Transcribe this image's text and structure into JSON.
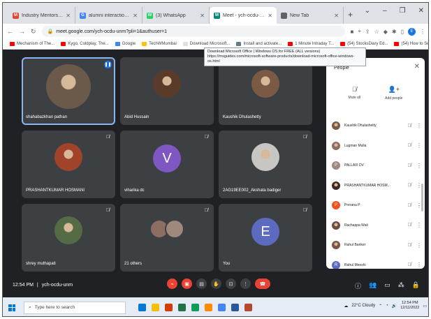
{
  "browser": {
    "tabs": [
      {
        "label": "Industry Mentorship 2022-2",
        "fav": "M",
        "color": "#ea4335",
        "active": false
      },
      {
        "label": "alumni interaction meet sp",
        "fav": "G",
        "color": "#4285f4",
        "active": false
      },
      {
        "label": "(3) WhatsApp",
        "fav": "W",
        "color": "#25d366",
        "active": false
      },
      {
        "label": "Meet - ych-ocdu-unm",
        "fav": "M",
        "color": "#00897b",
        "active": true
      },
      {
        "label": "New Tab",
        "fav": "",
        "color": "#5f6368",
        "active": false
      }
    ],
    "new_tab": "+",
    "url": "meet.google.com/ych-ocdu-unm?pli=1&authuser=1",
    "bookmarks": [
      "Mechanism of The...",
      "Kygo, Coldplay, The...",
      "Google",
      "TechWMumbai",
      "Download Microsoft...",
      "Install and activate...",
      "1 Minute Intraday T...",
      "(54) StocksDiary Ed...",
      "(54) How to Select..."
    ],
    "tooltip_line1": "Download Microsoft Office | Windows OS for FREE (ALL versions)",
    "tooltip_line2": "https://msguides.com/microsoft-software-products/download-microsoft-office-windows-os.html"
  },
  "meet": {
    "tiles": [
      {
        "name": "shahabazkhan pathan",
        "speaking": true,
        "avatar": "photo",
        "color": "#6b5a4a"
      },
      {
        "name": "Abid Hussain",
        "avatar": "photo",
        "color": "#5a3b2a"
      },
      {
        "name": "Kaushik Dhulashetty",
        "avatar": "photo",
        "color": "#7a5a45"
      },
      {
        "name": "PRASHANTKUMAR HOSMANI",
        "avatar": "photo",
        "color": "#a0432a"
      },
      {
        "name": "viharika dc",
        "avatar": "letter",
        "letter": "V",
        "color": "#7e57c2"
      },
      {
        "name": "2AG19EE002_Akshata badiger",
        "avatar": "photo",
        "color": "#c8c6c2"
      },
      {
        "name": "shrey muthapati",
        "avatar": "photo",
        "color": "#556b45"
      },
      {
        "name": "21 others",
        "avatar": "group",
        "color": "#8d6e63"
      },
      {
        "name": "You",
        "avatar": "letter",
        "letter": "E",
        "color": "#5c6bc0"
      }
    ],
    "time": "12:54 PM",
    "separator": "|",
    "meeting_code": "ych-ocdu-unm"
  },
  "people_panel": {
    "title": "People",
    "mute_all": "Mute all",
    "add_people": "Add people",
    "participants": [
      {
        "name": "Kaushik Dhulashetty",
        "letter": "",
        "color": "#7a5a45"
      },
      {
        "name": "Lugman Mulla",
        "letter": "",
        "color": "#8d6e63"
      },
      {
        "name": "PALLAVI DV",
        "letter": "P",
        "color": "#a1887f"
      },
      {
        "name": "PRASHANTKUMAR HOSM...",
        "letter": "",
        "color": "#3e2723"
      },
      {
        "name": "Prerana P",
        "letter": "P",
        "color": "#f4511e"
      },
      {
        "name": "Rachappa Wali",
        "letter": "",
        "color": "#6d4c41"
      },
      {
        "name": "Rahul Banker",
        "letter": "",
        "color": "#795548"
      },
      {
        "name": "Rahul Meeshi",
        "letter": "R",
        "color": "#5c6bc0"
      }
    ]
  },
  "taskbar": {
    "search_placeholder": "Type here to search",
    "weather": "22°C Cloudy",
    "time": "12:54 PM",
    "date": "12/11/2022",
    "apps": [
      "#0078d4",
      "#f2c200",
      "#d83b01",
      "#217346",
      "#0f9d58",
      "#ff8c00",
      "#4285f4",
      "#2b579a",
      "#b7472a"
    ]
  }
}
